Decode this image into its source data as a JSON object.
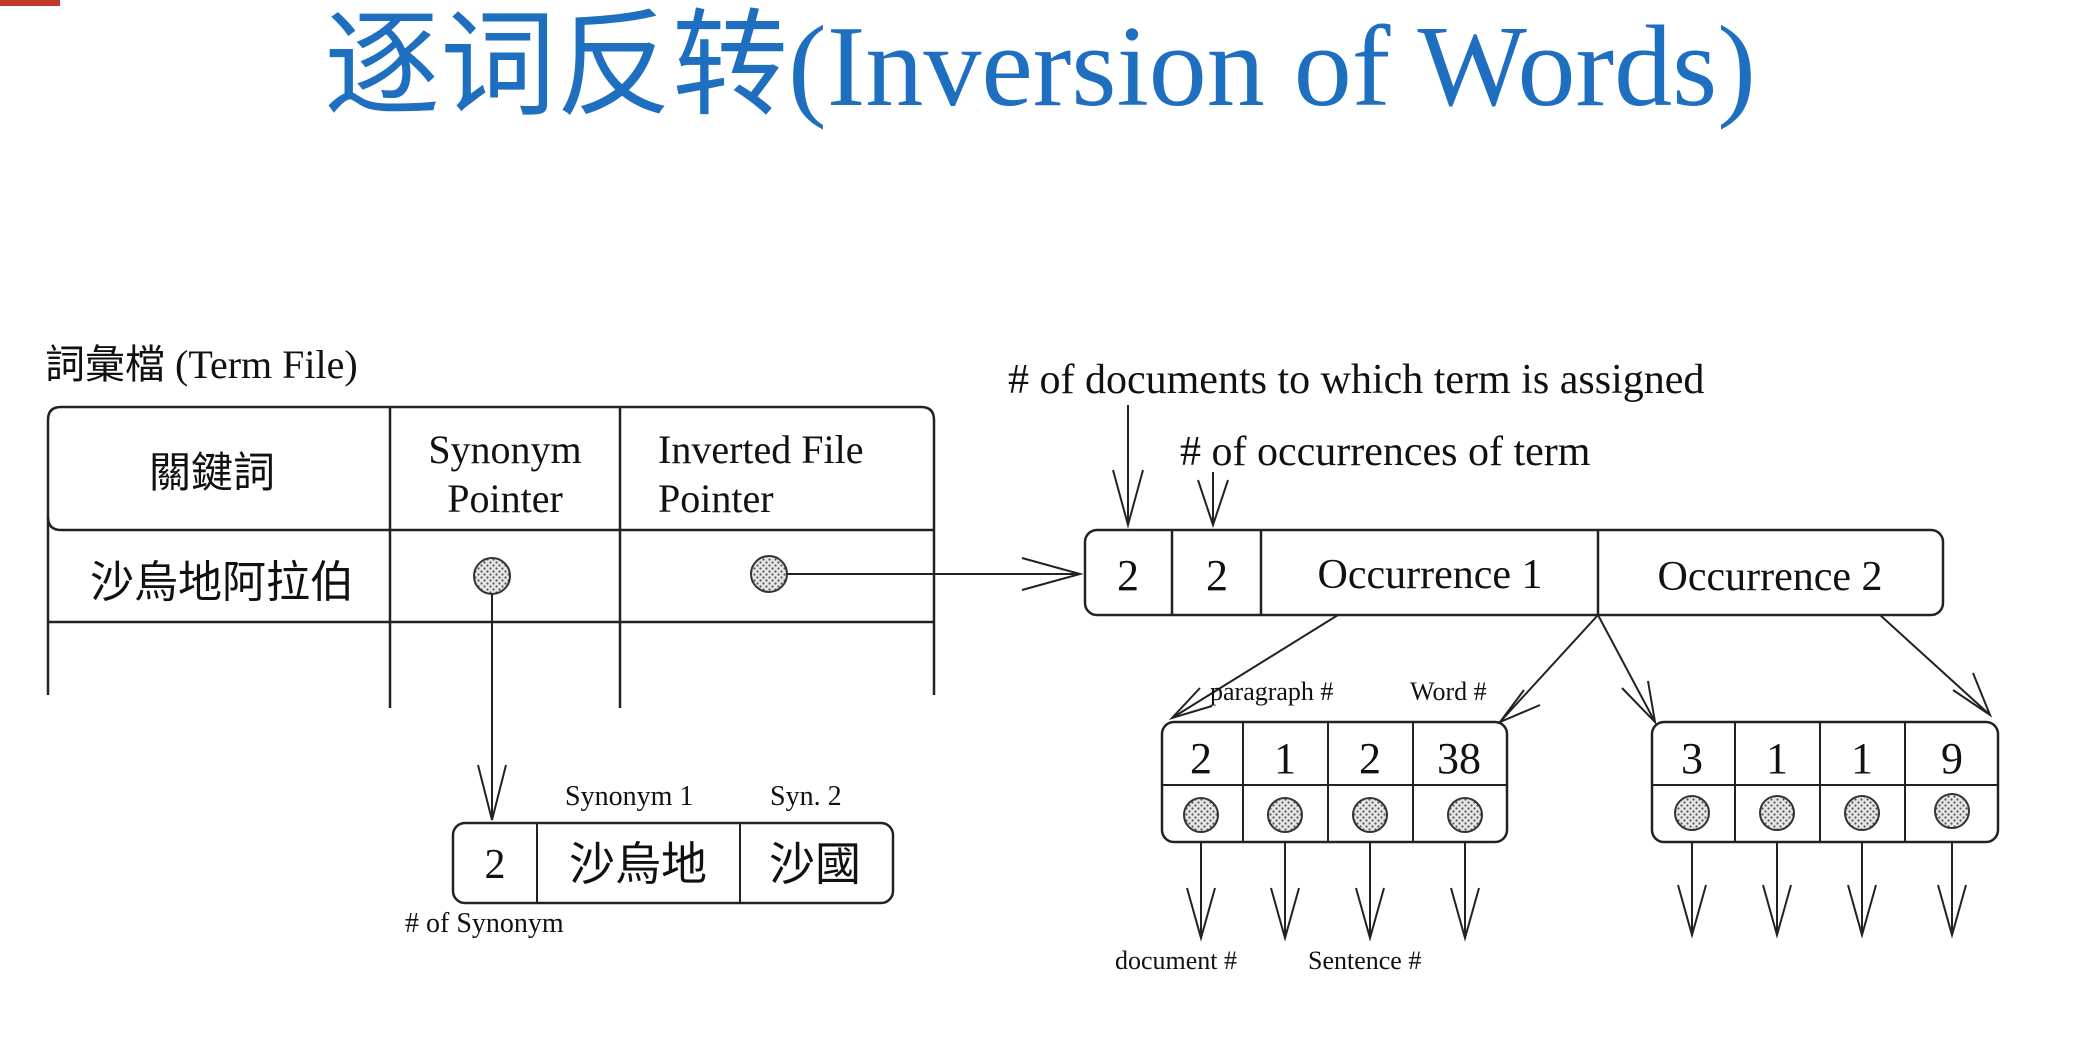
{
  "title": "逐词反转(Inversion of Words)",
  "colors": {
    "title": "#1f6fc1",
    "line": "#222222",
    "dot": "#999999"
  },
  "term_file": {
    "caption": "詞彙檔 (Term File)",
    "headers": [
      "關鍵詞",
      "Synonym Pointer",
      "Inverted File Pointer"
    ],
    "header_lines": [
      [
        "關鍵詞"
      ],
      [
        "Synonym",
        "Pointer"
      ],
      [
        "Inverted File",
        "Pointer"
      ]
    ],
    "row_term": "沙烏地阿拉伯"
  },
  "inverted": {
    "docs_label": "# of documents to which term is assigned",
    "occ_label": "# of occurrences of term",
    "cells": [
      "2",
      "2",
      "Occurrence 1",
      "Occurrence 2"
    ]
  },
  "occ1": {
    "values": [
      "2",
      "1",
      "2",
      "38"
    ],
    "labels": {
      "paragraph": "paragraph #",
      "word": "Word #",
      "document": "document #",
      "sentence": "Sentence #"
    }
  },
  "occ2": {
    "values": [
      "3",
      "1",
      "1",
      "9"
    ]
  },
  "synonyms": {
    "count": "2",
    "items": [
      "沙烏地",
      "沙國"
    ],
    "labels": {
      "syn1": "Synonym 1",
      "syn2": "Syn. 2",
      "count": "# of Synonym"
    }
  }
}
